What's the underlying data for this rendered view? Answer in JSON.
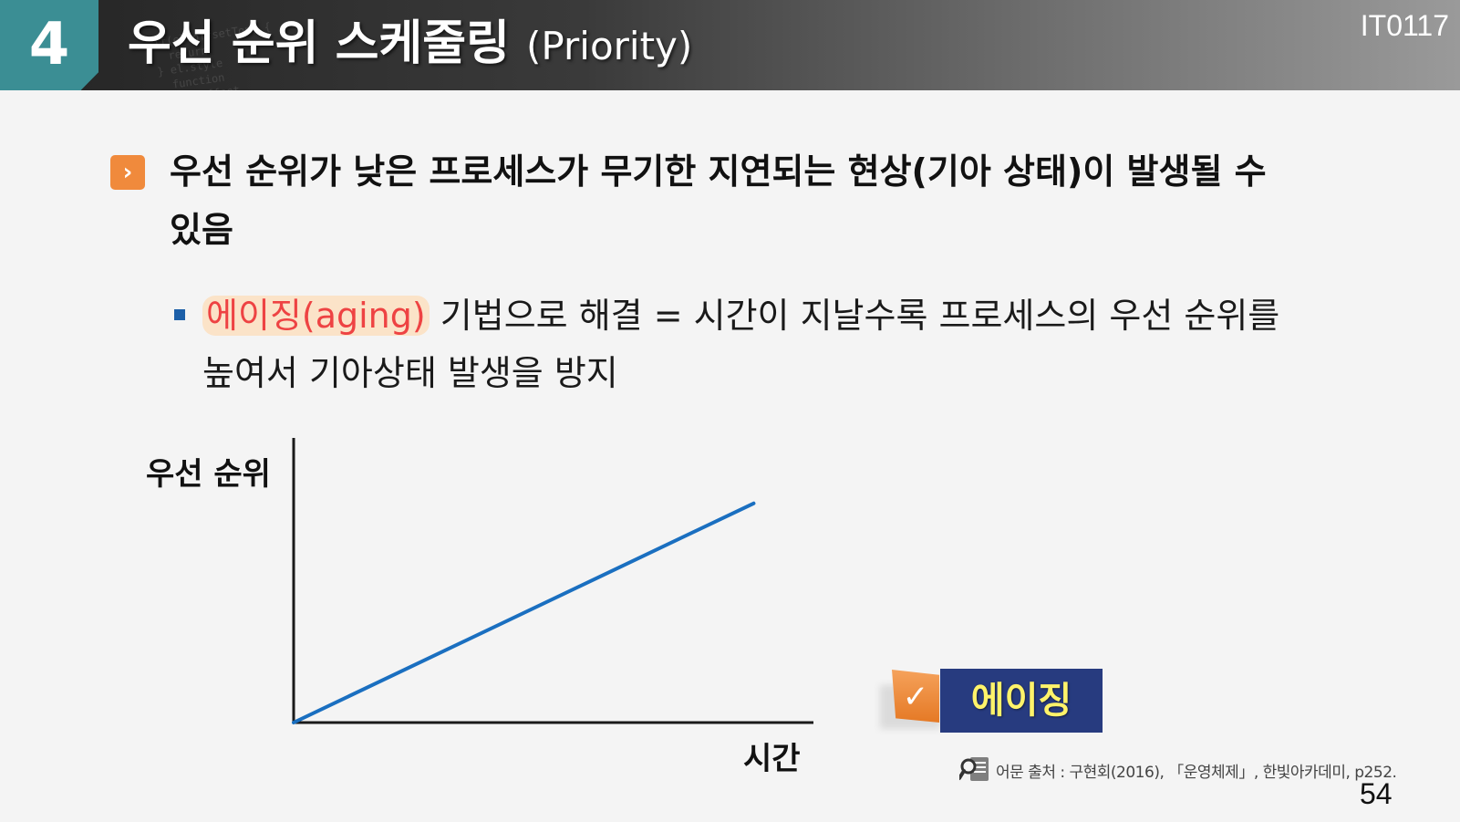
{
  "header": {
    "section_number": "4",
    "title_ko": "우선 순위 스케줄링",
    "title_en": "(Priority)",
    "course_code": "IT0117"
  },
  "content": {
    "main_bullet": "우선 순위가 낮은 프로세스가 무기한 지연되는 현상(기아 상태)이 발생될 수 있음",
    "sub_highlight": "에이징(aging)",
    "sub_text": " 기법으로 해결 = 시간이 지날수록 프로세스의 우선 순위를 높여서 기아상태 발생을 방지"
  },
  "chart_data": {
    "type": "line",
    "xlabel": "시간",
    "ylabel": "우선 순위",
    "series": [
      {
        "x": [
          0,
          1
        ],
        "y": [
          0,
          0.77
        ]
      }
    ],
    "xlim": [
      0,
      1.13
    ],
    "ylim": [
      0,
      1
    ],
    "line_color": "#1a6fc0"
  },
  "tag": {
    "label": "에이징"
  },
  "source": {
    "text": "어문 출처 : 구현회(2016), 「운영체제」, 한빛아카데미, p252."
  },
  "page": {
    "number": "54"
  },
  "colors": {
    "accent_teal": "#3b8e94",
    "accent_orange": "#f08a3c",
    "highlight_red": "#ee4343",
    "tag_navy": "#273b7f",
    "tag_yellow": "#fff36a"
  },
  "icons": {
    "main_bullet": "chevron-right-icon",
    "tag": "checkmark-icon",
    "source": "magnifier-icon"
  }
}
